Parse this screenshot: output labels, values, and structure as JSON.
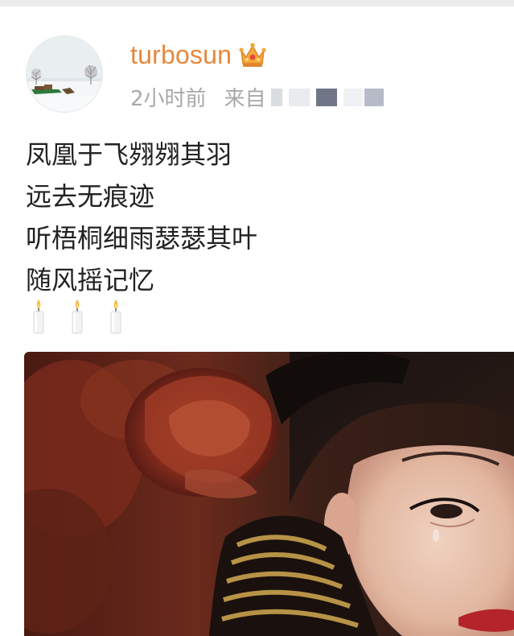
{
  "post": {
    "author": {
      "name": "turbosun",
      "avatar_icon": "snowy-landscape-avatar",
      "badge_icon": "crown-icon",
      "badge_color": "#e8873a"
    },
    "meta": {
      "time": "2小时前",
      "source_label": "来自"
    },
    "text_lines": [
      "凤凰于飞翙翙其羽",
      "远去无痕迹",
      "听梧桐细雨瑟瑟其叶",
      "随风摇记忆"
    ],
    "emojis": [
      "candle-icon",
      "candle-icon",
      "candle-icon"
    ],
    "image": {
      "description_icon": "tearful-woman-photo"
    }
  },
  "colors": {
    "username": "#e8873a",
    "meta": "#a8a8a8",
    "text": "#222222"
  }
}
